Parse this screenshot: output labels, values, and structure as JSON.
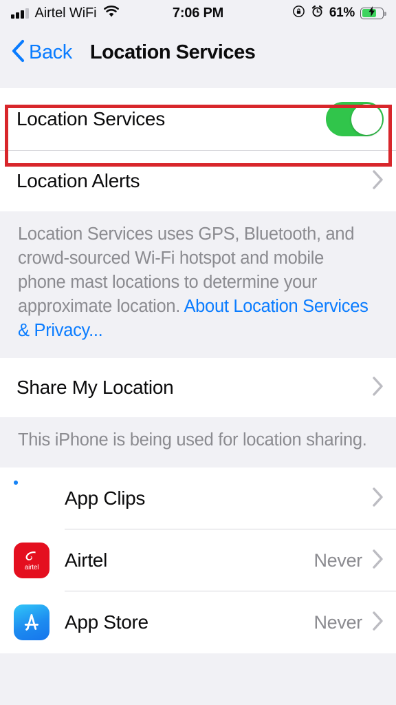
{
  "status_bar": {
    "carrier": "Airtel WiFi",
    "time": "7:06 PM",
    "battery_percent": "61%",
    "signal_icon": "signal-bars-icon",
    "wifi_icon": "wifi-icon",
    "rotation_lock_icon": "rotation-lock-icon",
    "alarm_icon": "alarm-clock-icon",
    "battery_icon": "battery-charging-icon"
  },
  "nav": {
    "back_label": "Back",
    "back_icon": "chevron-left-icon",
    "title": "Location Services"
  },
  "section_main": {
    "location_services": {
      "label": "Location Services",
      "toggle_on": true,
      "toggle_color": "#31C54B"
    },
    "location_alerts": {
      "label": "Location Alerts",
      "chevron_icon": "chevron-right-icon"
    },
    "footer_text_1": "Location Services uses GPS, Bluetooth, and crowd-sourced Wi-Fi hotspot and mobile phone mast locations to determine your approximate location. ",
    "footer_link": "About Location Services & Privacy..."
  },
  "section_share": {
    "share_my_location": {
      "label": "Share My Location",
      "chevron_icon": "chevron-right-icon"
    },
    "footer_text": "This iPhone is being used for location sharing."
  },
  "section_apps": {
    "rows": [
      {
        "label": "App Clips",
        "value": "",
        "icon": "app-clips-icon"
      },
      {
        "label": "Airtel",
        "value": "Never",
        "icon": "airtel-icon",
        "icon_word": "airtel"
      },
      {
        "label": "App Store",
        "value": "Never",
        "icon": "app-store-icon"
      }
    ]
  },
  "annotation": {
    "target": "Location Services",
    "color": "#D8262B"
  },
  "colors": {
    "accent_blue": "#0a7cff",
    "toggle_green": "#31C54B",
    "background_gray": "#F1F1F5",
    "secondary_text": "#8b8b90",
    "annotation_red": "#D8262B"
  }
}
